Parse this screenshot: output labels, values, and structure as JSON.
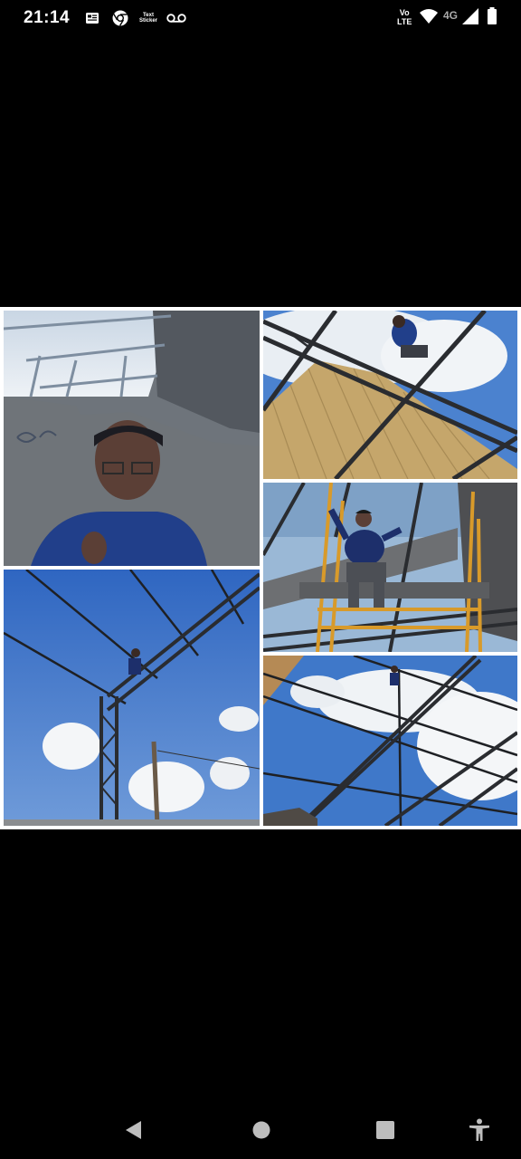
{
  "status_bar": {
    "time": "21:14",
    "notification_icons": [
      "news-icon",
      "chrome-icon",
      "text-sticker-icon",
      "voicemail-icon"
    ],
    "text_sticker_label_line1": "Text",
    "text_sticker_label_line2": "Sticker",
    "volte_line1": "Vo",
    "volte_line2": "LTE",
    "network_type": "4G",
    "system_icons": [
      "wifi-icon",
      "signal-icon",
      "battery-icon"
    ]
  },
  "collage": {
    "photos": [
      {
        "id": "selfie-under-roof",
        "icon": "photo"
      },
      {
        "id": "worker-on-truss-with-roof-panels",
        "icon": "photo"
      },
      {
        "id": "worker-on-scaffold-thumbs-up",
        "icon": "photo"
      },
      {
        "id": "worker-climbing-steel-column",
        "icon": "photo"
      },
      {
        "id": "steel-frame-structure-sky",
        "icon": "photo"
      }
    ]
  },
  "nav_bar": {
    "buttons": [
      "back-icon",
      "home-icon",
      "recents-icon",
      "accessibility-icon"
    ]
  },
  "colors": {
    "background": "#000000",
    "collage_border": "#ffffff",
    "sky": "#3f78c9",
    "roof_panel": "#c8a66a"
  }
}
